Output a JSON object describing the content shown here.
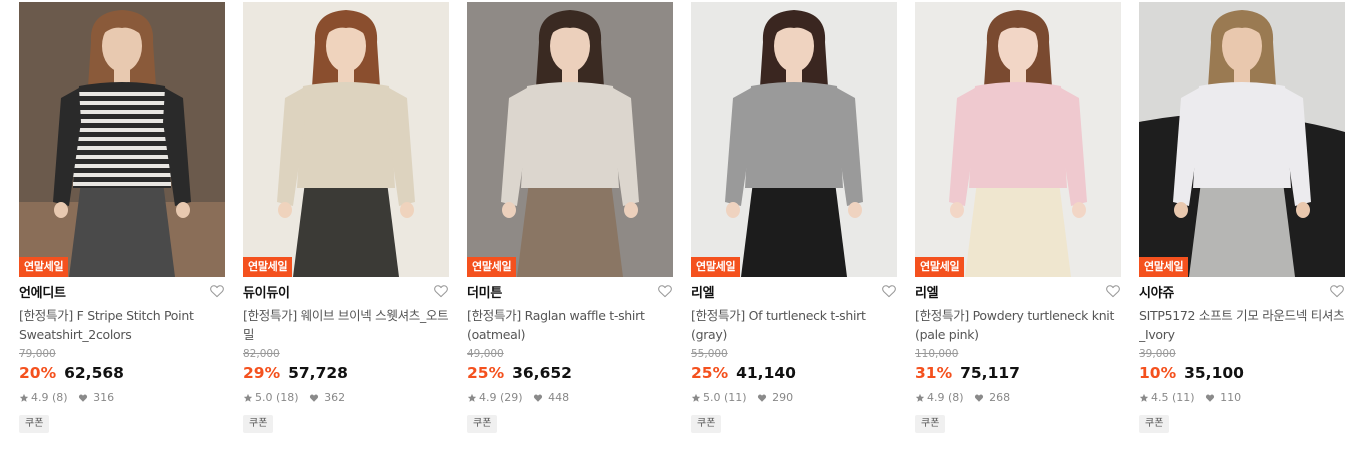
{
  "products": [
    {
      "badge": "연말세일",
      "brand": "언에디트",
      "title": "[한정특가] F Stripe Stitch Point Sweatshirt_2colors",
      "original_price": "79,000",
      "discount": "20%",
      "price": "62,568",
      "rating": "4.9",
      "review_count": "(8)",
      "likes": "316",
      "coupon": "쿠폰",
      "image": {
        "bg": "#6b5a4c",
        "top": "#2a2a2a",
        "top_alt": "#e8e6e2",
        "bottom": "#4a4a4a",
        "hair": "#8a5a3a",
        "skin": "#e8c9b0",
        "pattern": "stripe"
      }
    },
    {
      "badge": "연말세일",
      "brand": "듀이듀이",
      "title": "[한정특가] 웨이브 브이넥 스웻셔츠_오트밀",
      "original_price": "82,000",
      "discount": "29%",
      "price": "57,728",
      "rating": "5.0",
      "review_count": "(18)",
      "likes": "362",
      "coupon": "쿠폰",
      "image": {
        "bg": "#ece8e0",
        "top": "#ddd3bf",
        "top_alt": "#ddd3bf",
        "bottom": "#3b3a36",
        "hair": "#8a4e2e",
        "skin": "#efd3bd",
        "pattern": "plain"
      }
    },
    {
      "badge": "연말세일",
      "brand": "더미튼",
      "title": "[한정특가] Raglan waffle t-shirt (oatmeal)",
      "original_price": "49,000",
      "discount": "25%",
      "price": "36,652",
      "rating": "4.9",
      "review_count": "(29)",
      "likes": "448",
      "coupon": "쿠폰",
      "image": {
        "bg": "#8f8a86",
        "top": "#dcd6ce",
        "top_alt": "#dcd6ce",
        "bottom": "#8a7664",
        "hair": "#3a2a22",
        "skin": "#ecd0bc",
        "pattern": "plain"
      }
    },
    {
      "badge": "연말세일",
      "brand": "리엘",
      "title": "[한정특가] Of turtleneck t-shirt (gray)",
      "original_price": "55,000",
      "discount": "25%",
      "price": "41,140",
      "rating": "5.0",
      "review_count": "(11)",
      "likes": "290",
      "coupon": "쿠폰",
      "image": {
        "bg": "#e9e9e7",
        "top": "#9a9a9a",
        "top_alt": "#9a9a9a",
        "bottom": "#1c1c1c",
        "hair": "#3a2620",
        "skin": "#efd3c0",
        "pattern": "plain"
      }
    },
    {
      "badge": "연말세일",
      "brand": "리엘",
      "title": "[한정특가] Powdery turtleneck knit (pale pink)",
      "original_price": "110,000",
      "discount": "31%",
      "price": "75,117",
      "rating": "4.9",
      "review_count": "(8)",
      "likes": "268",
      "coupon": "쿠폰",
      "image": {
        "bg": "#ecebe8",
        "top": "#efc9cf",
        "top_alt": "#efc9cf",
        "bottom": "#efe6cf",
        "hair": "#7a4a30",
        "skin": "#f2d6c6",
        "pattern": "plain"
      }
    },
    {
      "badge": "연말세일",
      "brand": "시야쥬",
      "title": "SITP5172 소프트 기모 라운드넥 티셔츠_Ivory",
      "original_price": "39,000",
      "discount": "10%",
      "price": "35,100",
      "rating": "4.5",
      "review_count": "(11)",
      "likes": "110",
      "coupon": "쿠폰",
      "image": {
        "bg": "#d9d9d7",
        "top": "#ecebee",
        "top_alt": "#ecebee",
        "bottom": "#b6b6b4",
        "hair": "#9a7a52",
        "skin": "#e9c8ae",
        "pattern": "sofa"
      }
    }
  ],
  "colors": {
    "accent": "#f4511e",
    "text": "#111111",
    "muted": "#555555",
    "strike": "#999999"
  },
  "icons": {
    "wishlist": "heart-outline-icon",
    "rating": "star-icon",
    "likes": "heart-filled-icon"
  }
}
